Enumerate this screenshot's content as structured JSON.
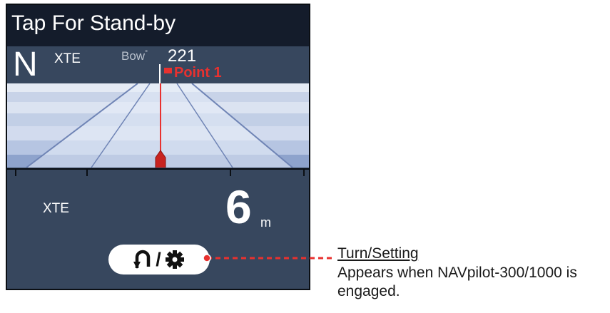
{
  "title_bar": {
    "text": "Tap For Stand-by"
  },
  "heading": {
    "north_indicator": "N",
    "xte_label": "XTE"
  },
  "bearing": {
    "label": "Bow",
    "degree_mark": "°",
    "value": "221"
  },
  "waypoint": {
    "name": "Point 1"
  },
  "xte": {
    "label": "XTE",
    "value": "6",
    "unit": "m"
  },
  "turn_setting_button": {
    "separator": "/",
    "turn_icon": "u-turn-icon",
    "setting_icon": "gear-icon"
  },
  "callout": {
    "title": "Turn/Setting",
    "description": "Appears when NAVpilot-300/1000 is engaged."
  },
  "colors": {
    "title_bar_bg": "#141c2b",
    "screen_bg": "#37475e",
    "waypoint_red": "#e8312f",
    "highway_light": "#dce4f2"
  }
}
